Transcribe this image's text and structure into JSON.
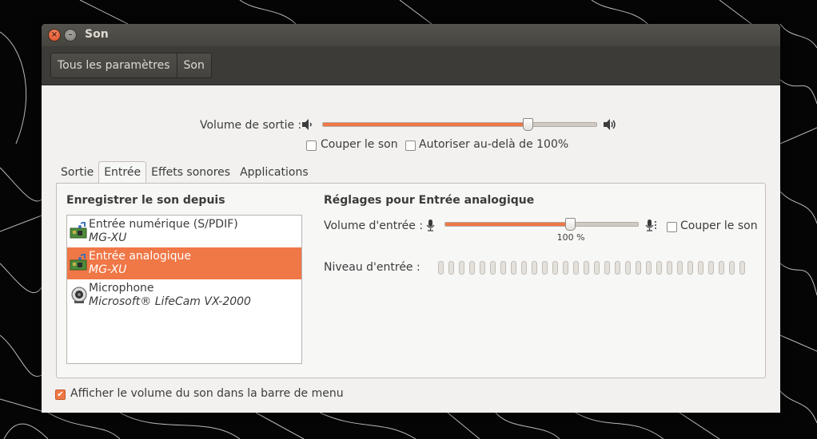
{
  "window": {
    "title": "Son",
    "close_glyph": "×",
    "minimize_glyph": "–"
  },
  "breadcrumb": {
    "items": [
      "Tous les paramètres",
      "Son"
    ]
  },
  "output": {
    "volume_label": "Volume de sortie :",
    "volume_level": 0.75,
    "mute_label": "Couper le son",
    "mute_checked": false,
    "overamplify_label": "Autoriser au-delà de 100%",
    "overamplify_checked": false
  },
  "tabs": [
    {
      "label": "Sortie",
      "active": false
    },
    {
      "label": "Entrée",
      "active": true
    },
    {
      "label": "Effets sonores",
      "active": false
    },
    {
      "label": "Applications",
      "active": false
    }
  ],
  "input": {
    "record_from_title": "Enregistrer le son depuis",
    "settings_title": "Réglages pour Entrée analogique",
    "devices": [
      {
        "name": "Entrée numérique (S/PDIF)",
        "sub": "MG-XU",
        "icon": "sound-card-icon",
        "selected": false
      },
      {
        "name": "Entrée analogique",
        "sub": "MG-XU",
        "icon": "sound-card-icon",
        "selected": true
      },
      {
        "name": "Microphone",
        "sub": "Microsoft® LifeCam VX-2000",
        "icon": "webcam-icon",
        "selected": false
      }
    ],
    "volume_label": "Volume d'entrée :",
    "volume_level": 1.0,
    "volume_percent_text": "100 %",
    "mute_label": "Couper le son",
    "mute_checked": false,
    "level_label": "Niveau d'entrée :",
    "level_segments": 30,
    "level_lit": 0
  },
  "footer": {
    "show_in_menu_label": "Afficher le volume du son dans la barre de menu",
    "show_in_menu_checked": true,
    "check_glyph": "✔"
  },
  "colors": {
    "accent": "#f07746",
    "titlebar": "#46443f",
    "toolbar": "#3c3b37",
    "window_bg": "#f2f1f0"
  }
}
